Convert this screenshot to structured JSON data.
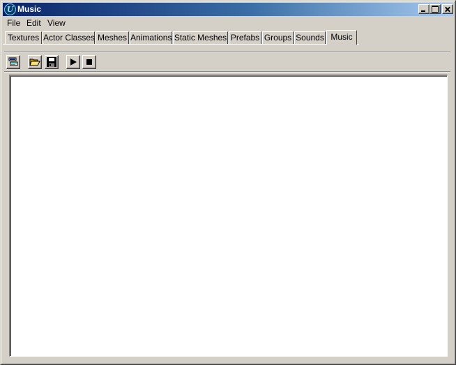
{
  "window": {
    "title": "Music",
    "app_icon_letter": "U",
    "controls": [
      "minimize",
      "maximize",
      "close"
    ]
  },
  "menu": {
    "items": [
      "File",
      "Edit",
      "View"
    ]
  },
  "tabs": {
    "items": [
      "Textures",
      "Actor Classes",
      "Meshes",
      "Animations",
      "Static Meshes",
      "Prefabs",
      "Groups",
      "Sounds",
      "Music"
    ],
    "active": "Music"
  },
  "toolbar": {
    "buttons": [
      "browse-icon",
      "open-folder-icon",
      "save-icon",
      "play-icon",
      "stop-icon"
    ]
  },
  "colors": {
    "title_start": "#0a246a",
    "title_end": "#a6caf0",
    "face": "#d4d0c8"
  }
}
